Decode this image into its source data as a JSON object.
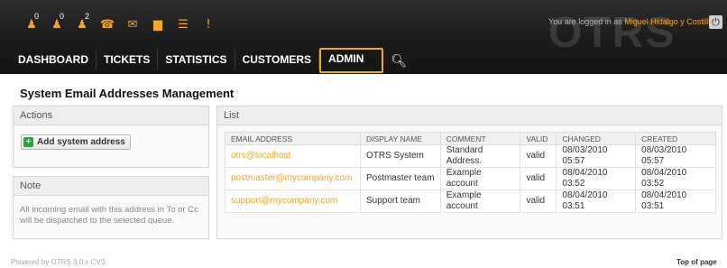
{
  "toolbar": {
    "items": [
      {
        "icon": "person-lock-icon",
        "glyph": "♟",
        "count": "0"
      },
      {
        "icon": "person-unlock-icon",
        "glyph": "♟",
        "count": "0"
      },
      {
        "icon": "person-icon",
        "glyph": "♟",
        "count": "2"
      },
      {
        "icon": "phone-icon",
        "glyph": "☎",
        "count": ""
      },
      {
        "icon": "email-icon",
        "glyph": "✉",
        "count": ""
      },
      {
        "icon": "folder-icon",
        "glyph": "▆",
        "count": ""
      },
      {
        "icon": "list-icon",
        "glyph": "☰",
        "count": ""
      },
      {
        "icon": "alert-icon",
        "glyph": "!",
        "count": ""
      }
    ]
  },
  "header": {
    "login_prefix": "You are logged in as",
    "user_name": "Miguel Hidalgo y Costilla",
    "logo": "OTRS"
  },
  "nav": {
    "dashboard": "DASHBOARD",
    "tickets": "TICKETS",
    "statistics": "STATISTICS",
    "customers": "CUSTOMERS",
    "admin": "ADMIN"
  },
  "page": {
    "title": "System Email Addresses Management"
  },
  "actions": {
    "header": "Actions",
    "add_button": "Add system address"
  },
  "note": {
    "header": "Note",
    "text": "All incoming email with this address in To or Cc will be dispatched to the selected queue."
  },
  "list": {
    "header": "List",
    "columns": [
      "EMAIL ADDRESS",
      "DISPLAY NAME",
      "COMMENT",
      "VALID",
      "CHANGED",
      "CREATED"
    ],
    "rows": [
      [
        "otrs@localhost",
        "OTRS System",
        "Standard Address.",
        "valid",
        "08/03/2010 05:57",
        "08/03/2010 05:57"
      ],
      [
        "postmaster@mycompany.com",
        "Postmaster team",
        "Example account",
        "valid",
        "08/04/2010 03:52",
        "08/04/2010 03:52"
      ],
      [
        "support@mycompany.com",
        "Support team",
        "Example account",
        "valid",
        "08/04/2010 03:51",
        "08/04/2010 03:51"
      ]
    ]
  },
  "footer": {
    "powered_by": "Powered by OTRS 3.0.x CVS",
    "top_of_page": "Top of page"
  },
  "colors": {
    "accent": "#f5a623",
    "header_bg": "#1a1a1a",
    "add_icon": "#2ea13a"
  }
}
